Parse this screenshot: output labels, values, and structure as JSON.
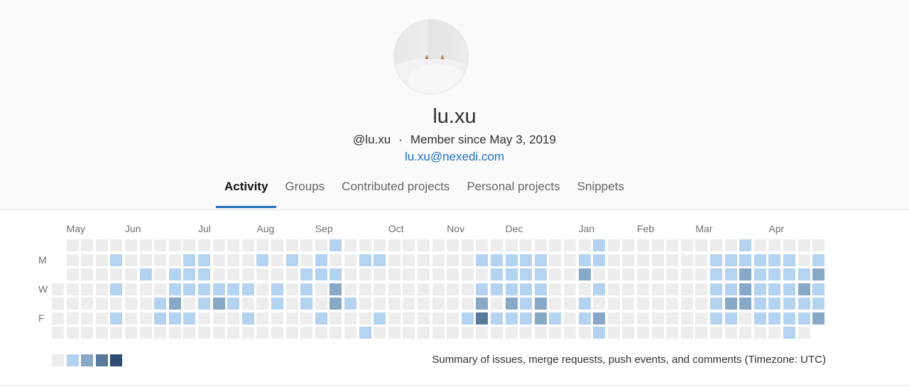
{
  "profile": {
    "avatar_alt": "dog-under-blanket avatar",
    "display_name": "lu.xu",
    "username": "@lu.xu",
    "separator": "·",
    "member_since": "Member since May 3, 2019",
    "email": "lu.xu@nexedi.com"
  },
  "tabs": [
    {
      "label": "Activity",
      "active": true
    },
    {
      "label": "Groups",
      "active": false
    },
    {
      "label": "Contributed projects",
      "active": false
    },
    {
      "label": "Personal projects",
      "active": false
    },
    {
      "label": "Snippets",
      "active": false
    }
  ],
  "calendar": {
    "colors": [
      "#ededed",
      "#b4d3f0",
      "#87a8c6",
      "#5a7a9c",
      "#2f4e73"
    ],
    "accent": "#1f6fc0",
    "day_labels": [
      {
        "row": 1,
        "label": "M"
      },
      {
        "row": 3,
        "label": "W"
      },
      {
        "row": 5,
        "label": "F"
      }
    ],
    "months": [
      {
        "label": "May",
        "col": 1
      },
      {
        "label": "Jun",
        "col": 5
      },
      {
        "label": "Jul",
        "col": 10
      },
      {
        "label": "Aug",
        "col": 14
      },
      {
        "label": "Sep",
        "col": 18
      },
      {
        "label": "Oct",
        "col": 23
      },
      {
        "label": "Nov",
        "col": 27
      },
      {
        "label": "Dec",
        "col": 31
      },
      {
        "label": "Jan",
        "col": 36
      },
      {
        "label": "Feb",
        "col": 40
      },
      {
        "label": "Mar",
        "col": 44
      },
      {
        "label": "Apr",
        "col": 49
      }
    ],
    "weeks": 53,
    "first_week_start_row": 3,
    "last_week_end_row": 5,
    "levels_by_row": [
      "0000000000000000001000000000000000001000000000100000",
      "0001000011000101010011000000111110011000000011111101",
      "0000010111000000111000000000011110020000000011211112",
      "0001000111111010102000000000111110001000000011211121",
      "0000001201210010102100000000202120010000000012211111",
      "0001001110001000010001000001311121012000000011011112",
      "0000000000000000000010000000000000001000000000000100"
    ],
    "legend_levels": [
      0,
      1,
      2,
      3,
      4
    ],
    "summary": "Summary of issues, merge requests, push events, and comments (Timezone: UTC)"
  }
}
